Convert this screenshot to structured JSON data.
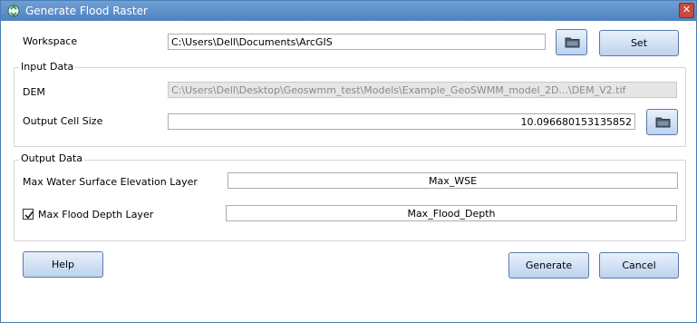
{
  "window": {
    "title": "Generate Flood Raster",
    "close_glyph": "✕"
  },
  "workspace": {
    "label": "Workspace",
    "value": "C:\\Users\\Dell\\Documents\\ArcGIS",
    "folder_icon": "folder-icon",
    "set_label": "Set"
  },
  "input_data": {
    "title": "Input Data",
    "dem_label": "DEM",
    "dem_value": "C:\\Users\\Dell\\Desktop\\Geoswmm_test\\Models\\Example_GeoSWMM_model_2D...\\DEM_V2.tif",
    "cell_size_label": "Output Cell Size",
    "cell_size_value": "10.096680153135852",
    "folder_icon": "folder-icon"
  },
  "output_data": {
    "title": "Output Data",
    "wse_label": "Max Water Surface Elevation Layer",
    "wse_value": "Max_WSE",
    "flood_depth_label": "Max Flood Depth Layer",
    "flood_depth_checked": true,
    "flood_depth_value": "Max_Flood_Depth"
  },
  "buttons": {
    "help": "Help",
    "generate": "Generate",
    "cancel": "Cancel"
  },
  "colors": {
    "titlebar": "#5a8cca",
    "button_border": "#5b79a8",
    "close": "#c94a3a"
  }
}
